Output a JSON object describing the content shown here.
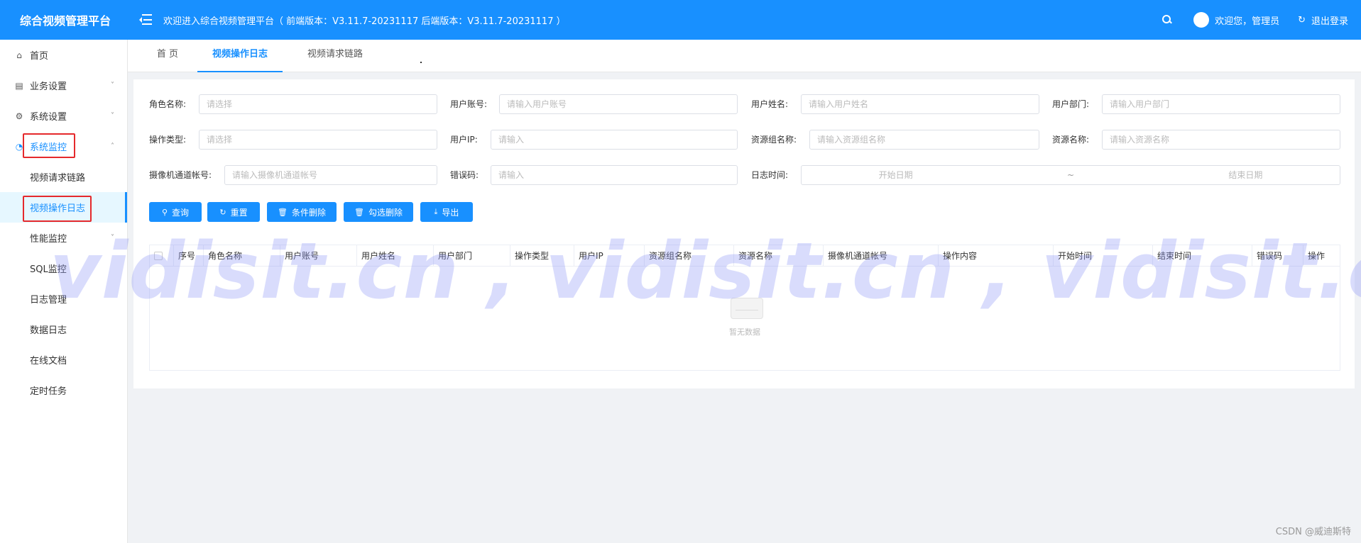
{
  "header": {
    "brand": "综合视频管理平台",
    "welcome": "欢迎进入综合视频管理平台（ 前端版本：V3.11.7-20231117 后端版本：V3.11.7-20231117 ）",
    "user_greeting": "欢迎您，管理员",
    "logout": "退出登录",
    "logout_icon": "↻"
  },
  "sidebar": {
    "items": [
      {
        "label": "首页",
        "icon": "home-icon",
        "glyph": "⌂"
      },
      {
        "label": "业务设置",
        "icon": "calendar-icon",
        "glyph": "▤",
        "arrow": "˅"
      },
      {
        "label": "系统设置",
        "icon": "gear-icon",
        "glyph": "⚙",
        "arrow": "˅"
      },
      {
        "label": "系统监控",
        "icon": "gauge-icon",
        "glyph": "◔",
        "arrow": "˄"
      },
      {
        "label": "视频请求链路"
      },
      {
        "label": "视频操作日志"
      },
      {
        "label": "性能监控",
        "arrow": "˅"
      },
      {
        "label": "SQL监控"
      },
      {
        "label": "日志管理"
      },
      {
        "label": "数据日志"
      },
      {
        "label": "在线文档"
      },
      {
        "label": "定时任务"
      }
    ]
  },
  "tabs": [
    "首 页",
    "视频操作日志",
    "视频请求链路"
  ],
  "filters": {
    "role_name": {
      "label": "角色名称:",
      "placeholder": "请选择"
    },
    "user_account": {
      "label": "用户账号:",
      "placeholder": "请输入用户账号"
    },
    "user_name": {
      "label": "用户姓名:",
      "placeholder": "请输入用户姓名"
    },
    "user_dept": {
      "label": "用户部门:",
      "placeholder": "请输入用户部门"
    },
    "op_type": {
      "label": "操作类型:",
      "placeholder": "请选择"
    },
    "user_ip": {
      "label": "用户IP:",
      "placeholder": "请输入"
    },
    "res_group": {
      "label": "资源组名称:",
      "placeholder": "请输入资源组名称"
    },
    "res_name": {
      "label": "资源名称:",
      "placeholder": "请输入资源名称"
    },
    "camera_channel": {
      "label": "摄像机通道帐号:",
      "placeholder": "请输入摄像机通道帐号"
    },
    "error_code": {
      "label": "错误码:",
      "placeholder": "请输入"
    },
    "log_time": {
      "label": "日志时间:",
      "start": "开始日期",
      "sep": "~",
      "end": "结束日期"
    }
  },
  "buttons": {
    "query": "查询",
    "reset": "重置",
    "delete_by_condition": "条件删除",
    "delete_selected": "勾选删除",
    "export": "导出"
  },
  "table": {
    "columns": [
      "序号",
      "角色名称",
      "用户账号",
      "用户姓名",
      "用户部门",
      "操作类型",
      "用户IP",
      "资源组名称",
      "资源名称",
      "摄像机通道帐号",
      "操作内容",
      "开始时间",
      "结束时间",
      "错误码",
      "操作"
    ],
    "empty_text": "暂无数据"
  },
  "watermark": "vidisit.cn , vidisit.cn , vidisit.cn",
  "footer_credit": "CSDN @威迪斯特",
  "colors": {
    "primary": "#1890ff",
    "highlight_box": "#e5292c"
  }
}
